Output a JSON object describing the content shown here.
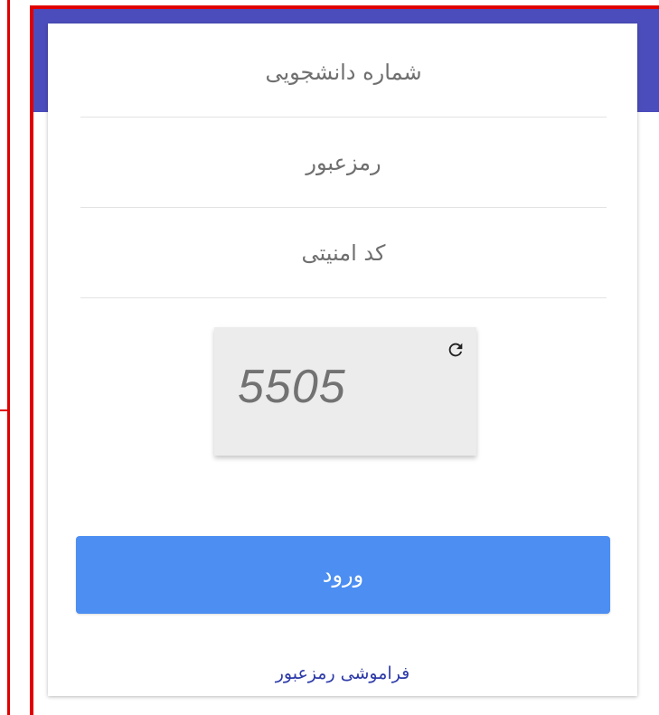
{
  "form": {
    "student_number_placeholder": "شماره دانشجویی",
    "password_placeholder": "رمزعبور",
    "security_code_placeholder": "کد امنیتی"
  },
  "captcha": {
    "code": "5505",
    "refresh_icon": "refresh-icon"
  },
  "actions": {
    "login_label": "ورود",
    "forgot_password_label": "فراموشی رمزعبور"
  },
  "colors": {
    "header_band": "#4c4dbd",
    "primary_button": "#4c8ef2",
    "link": "#2d3aa8",
    "frame_border": "#e00000"
  }
}
